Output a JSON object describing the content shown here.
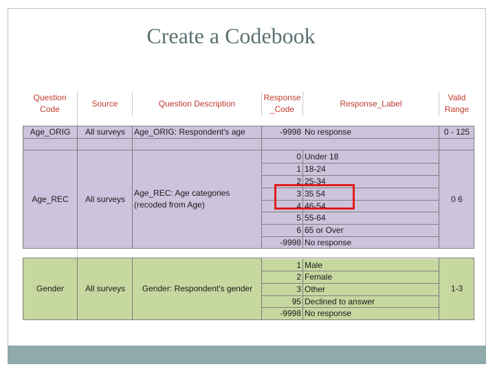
{
  "slide": {
    "title": "Create a Codebook"
  },
  "table": {
    "headers": {
      "question_code": "Question Code",
      "source": "Source",
      "question_description": "Question Description",
      "response_code": "Response _Code",
      "response_label": "Response_Label",
      "valid_range": "Valid Range"
    },
    "age_orig": {
      "question_code": "Age_ORIG",
      "source": "All surveys",
      "description": "Age_ORIG: Respondent's age",
      "code": "-9998",
      "label": "No response",
      "range": "0 - 125"
    },
    "age_rec": {
      "question_code": "Age_REC",
      "source": "All surveys",
      "description": "Age_REC: Age categories (recoded from Age)",
      "range": "0 6",
      "responses": [
        {
          "code": "0",
          "label": "Under 18"
        },
        {
          "code": "1",
          "label": "18-24"
        },
        {
          "code": "2",
          "label": "25-34"
        },
        {
          "code": "3",
          "label": "35 54"
        },
        {
          "code": "4",
          "label": "46-54"
        },
        {
          "code": "5",
          "label": "55-64"
        },
        {
          "code": "6",
          "label": "65 or Over"
        },
        {
          "code": "-9998",
          "label": "No response"
        }
      ]
    },
    "gender": {
      "question_code": "Gender",
      "source": "All surveys",
      "description": "Gender: Respondent's gender",
      "range": "1-3",
      "responses": [
        {
          "code": "1",
          "label": "Male"
        },
        {
          "code": "2",
          "label": "Female"
        },
        {
          "code": "3",
          "label": "Other"
        },
        {
          "code": "95",
          "label": "Declined to answer"
        },
        {
          "code": "-9998",
          "label": "No response"
        }
      ]
    }
  },
  "colors": {
    "purple_rows": "#cdc3dc",
    "green_rows": "#c6d8a0",
    "header_text": "#c0392b",
    "highlight": "#e01b1b"
  }
}
